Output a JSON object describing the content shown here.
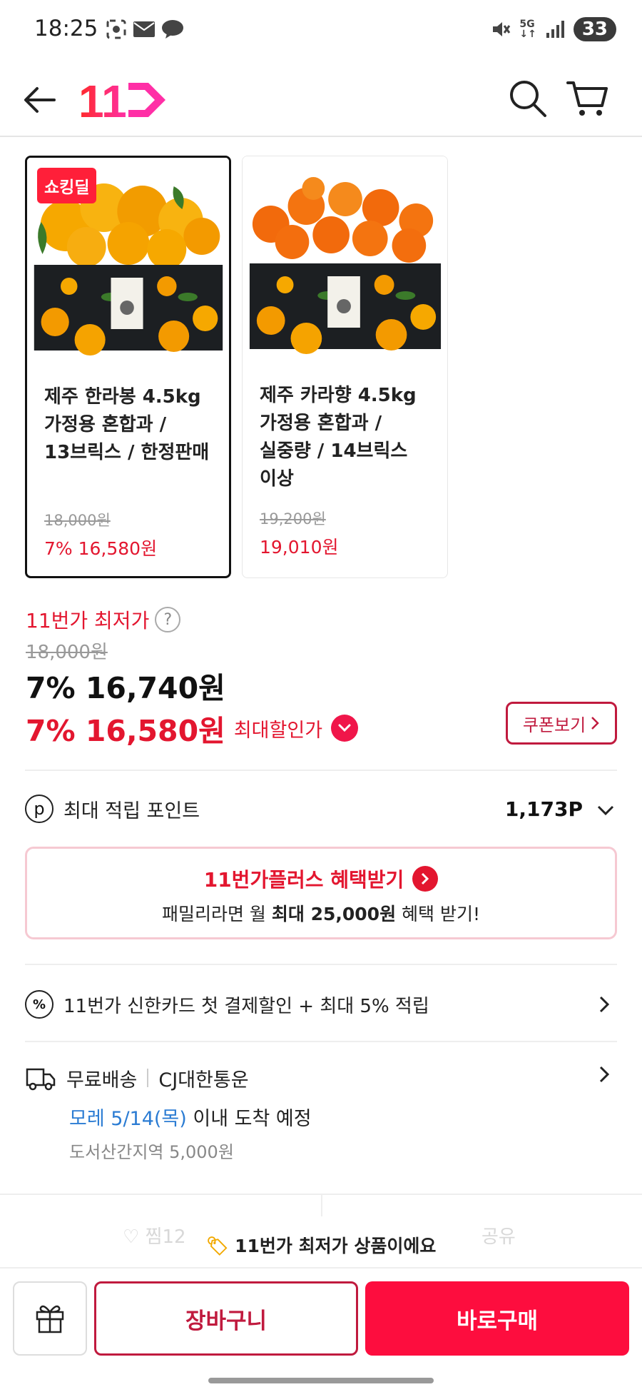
{
  "status": {
    "time": "18:25",
    "battery": "33",
    "network": "5G"
  },
  "header": {
    "logo_text": "11"
  },
  "products": [
    {
      "badge": "쇼킹딜",
      "title": "제주 한라봉 4.5kg 가정용 혼합과 / 13브릭스 / 한정판매",
      "original_price": "18,000원",
      "sale_price": "7% 16,580원"
    },
    {
      "badge": "",
      "title": "제주 카라향 4.5kg 가정용 혼합과 / 실중량 / 14브릭스 이상",
      "original_price": "19,200원",
      "sale_price": "19,010원"
    }
  ],
  "pricing": {
    "lowest_label": "11번가 최저가",
    "help": "?",
    "original": "18,000원",
    "discount_price": "7% 16,740원",
    "max_discount_price": "7% 16,580원",
    "max_discount_label": "최대할인가",
    "coupon_button": "쿠폰보기"
  },
  "points": {
    "icon": "p",
    "label": "최대 적립 포인트",
    "value": "1,173P"
  },
  "plus_banner": {
    "title": "11번가플러스 혜택받기",
    "sub_prefix": "패밀리라면 월 ",
    "sub_bold": "최대 25,000원",
    "sub_suffix": " 혜택 받기!"
  },
  "card_promo": {
    "icon": "%",
    "text": "11번가 신한카드 첫 결제할인 + 최대 5% 적립"
  },
  "delivery": {
    "type": "무료배송",
    "carrier": "CJ대한통운",
    "eta_blue": "모레 5/14(목)",
    "eta_rest": " 이내 도착 예정",
    "extra_fee": "도서산간지역 5,000원"
  },
  "share_bar": {
    "like": "♡ 찜12",
    "share": "공유",
    "toast": "11번가 최저가 상품이에요"
  },
  "actions": {
    "cart": "장바구니",
    "buy": "바로구매"
  },
  "colors": {
    "accent": "#e3162f",
    "buy": "#fd0d3e",
    "link_blue": "#2b7cd3"
  }
}
